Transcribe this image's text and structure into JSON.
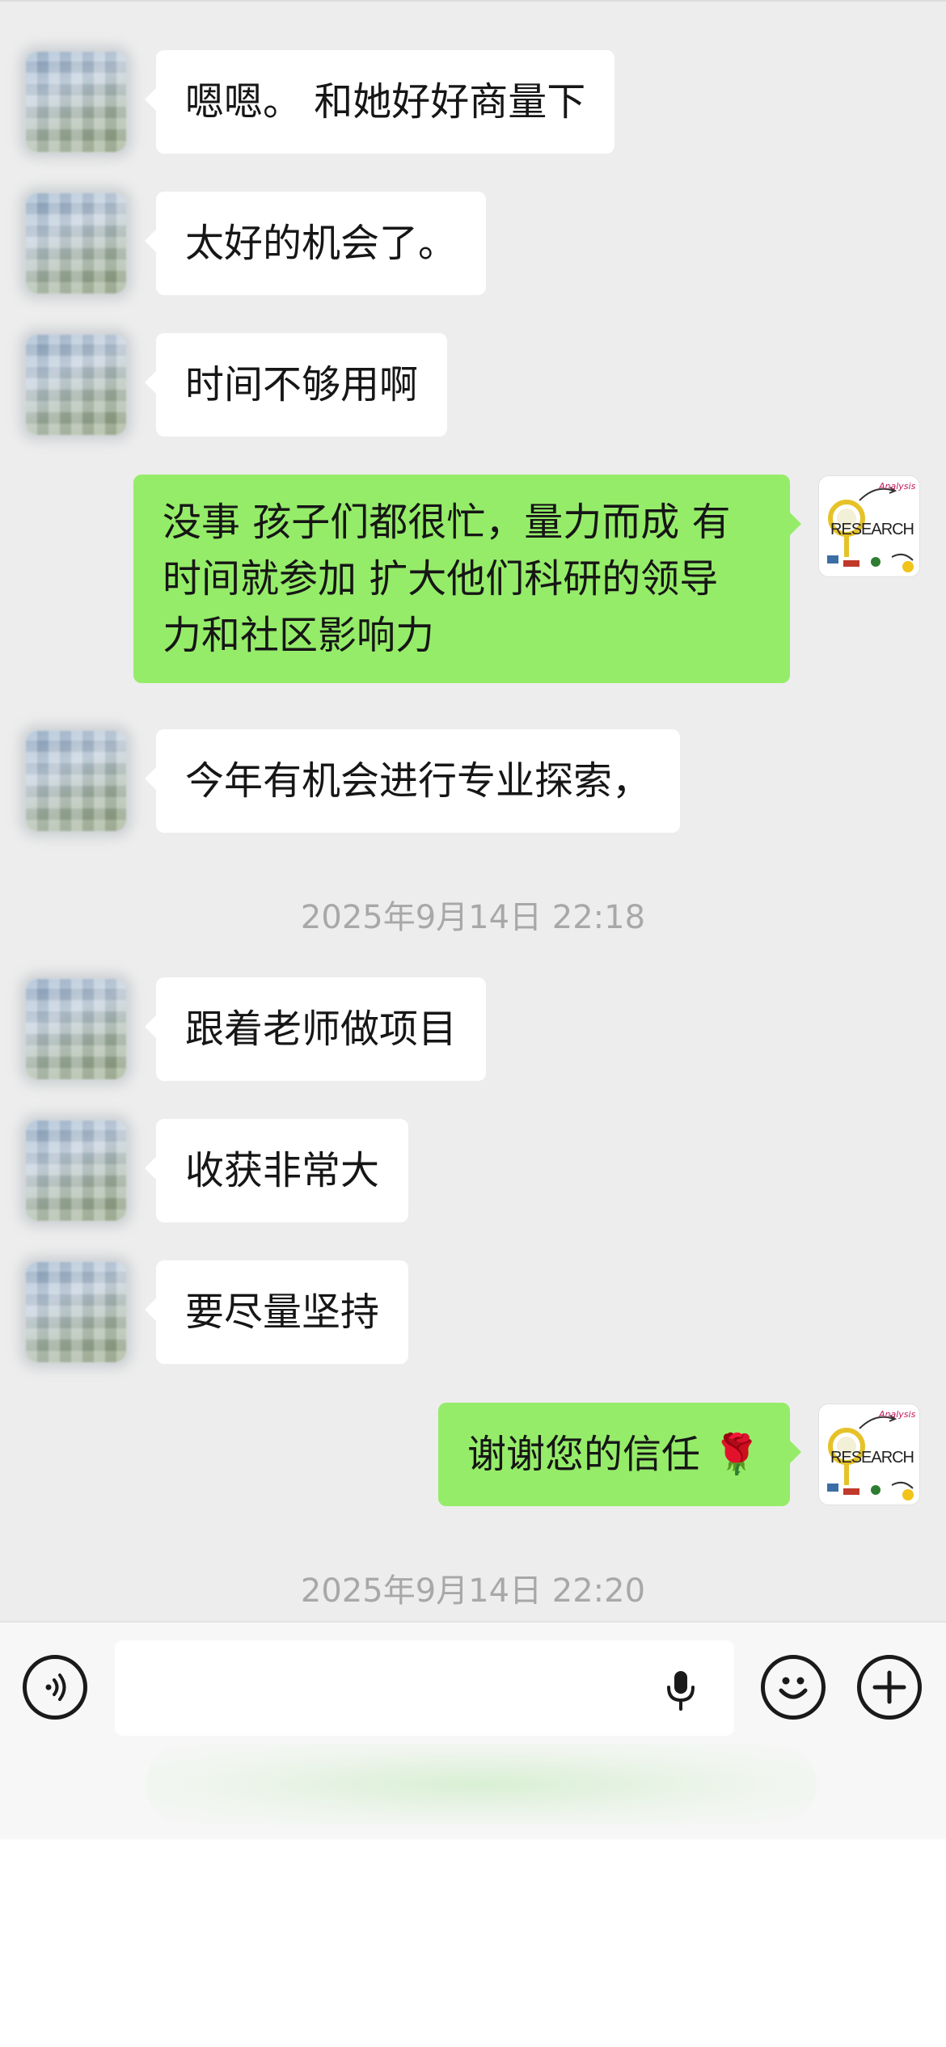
{
  "messages": [
    {
      "side": "in",
      "text": "嗯嗯。 和她好好商量下"
    },
    {
      "side": "in",
      "text": "太好的机会了。"
    },
    {
      "side": "in",
      "text": "时间不够用啊"
    },
    {
      "side": "out",
      "lines": [
        "没事 孩子们都很忙，量力而成 有",
        "时间就参加 扩大他们科研的领导",
        "力和社区影响力"
      ]
    },
    {
      "side": "in",
      "text": "今年有机会进行专业探索，"
    },
    {
      "side": "in",
      "text": "跟着老师做项目"
    },
    {
      "side": "in",
      "text": "收获非常大"
    },
    {
      "side": "in",
      "text": "要尽量坚持"
    },
    {
      "side": "out",
      "text": "谢谢您的信任 🌹"
    }
  ],
  "timestamps": [
    "2025年9月14日 22:18",
    "2025年9月14日 22:20"
  ],
  "self_avatar": {
    "label": "RESEARCH",
    "small_label": "Analysis"
  },
  "input_bar": {
    "placeholder": "",
    "voice_icon": "voice-icon",
    "mic_icon": "microphone-icon",
    "emoji_icon": "emoji-icon",
    "plus_icon": "plus-icon"
  },
  "colors": {
    "chat_background": "#ededed",
    "incoming_bubble": "#ffffff",
    "outgoing_bubble": "#95ec69",
    "timestamp_text": "#a8a8a8"
  }
}
